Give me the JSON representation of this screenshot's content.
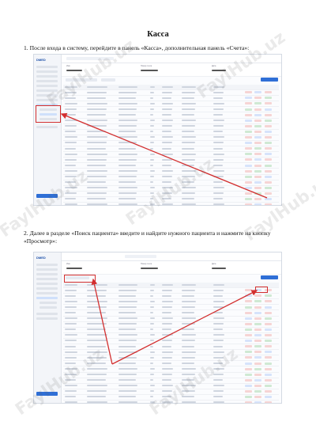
{
  "title": "Касса",
  "steps": [
    {
      "text": "1.    После входа в систему, перейдите в панель «Касса», дополнительная панель «Счета»:"
    },
    {
      "text": "2.    Далее в разделе «Поиск пациента» введите и найдите нужного пациента и нажмите на кнопку «Просмотр»:"
    }
  ],
  "screenshot": {
    "logo": "DMED",
    "card1_label": "Имя",
    "card2_label": "Номер счета",
    "card3_label": "Дата",
    "sidebar_items": [
      "",
      "",
      "",
      "",
      "",
      "",
      "",
      "",
      "",
      "",
      "",
      ""
    ]
  },
  "watermark": "FaylHub.uz",
  "colors": {
    "annotation": "#d32f2f",
    "accent": "#2f6fd6",
    "sidebar": "#f3f5f9"
  }
}
